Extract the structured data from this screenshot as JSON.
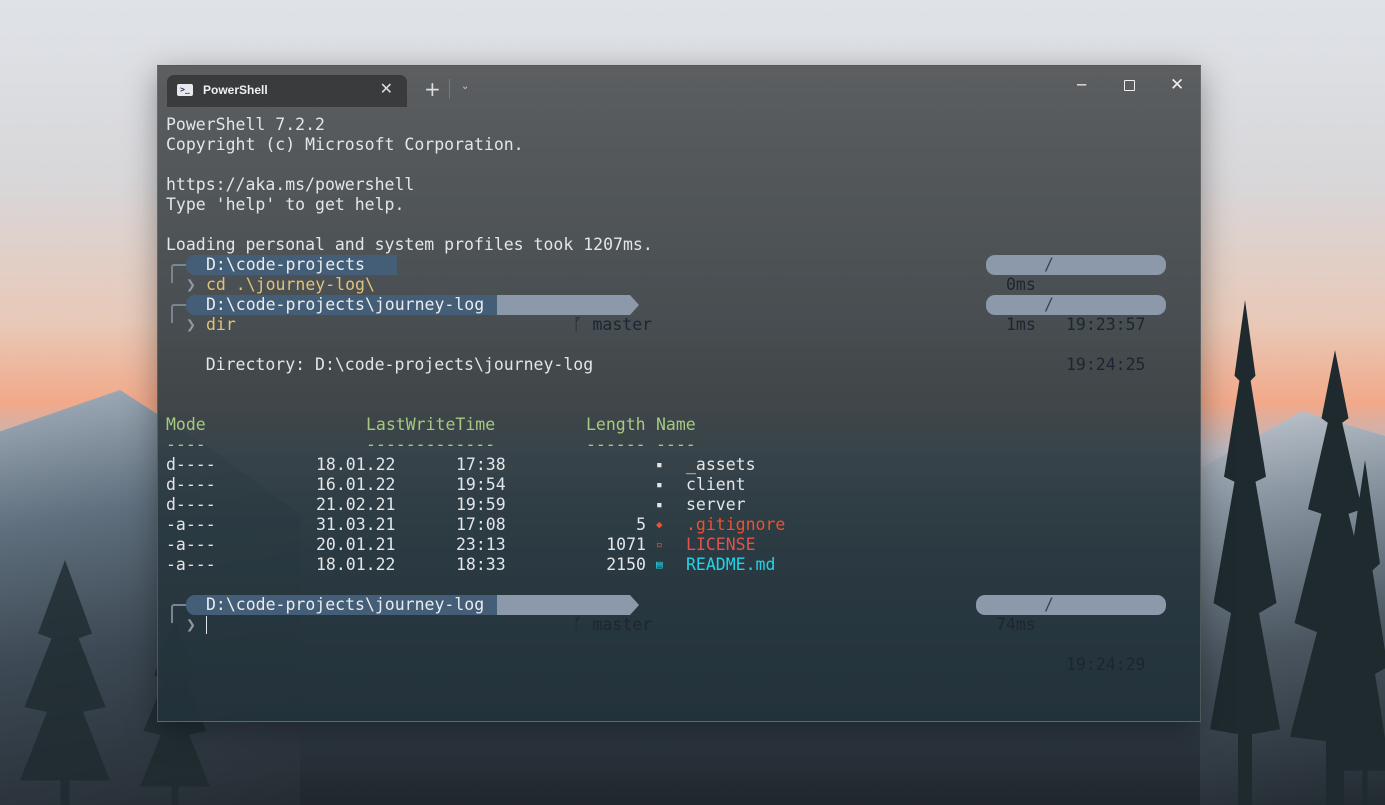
{
  "window": {
    "tab_title": "PowerShell",
    "tab_icon": "powershell-icon",
    "close_icon": "close-icon",
    "new_tab_icon": "plus-icon",
    "dropdown_icon": "chevron-down-icon",
    "controls": [
      "minimize-icon",
      "maximize-icon",
      "close-icon"
    ]
  },
  "banner": [
    "PowerShell 7.2.2",
    "Copyright (c) Microsoft Corporation.",
    "",
    "https://aka.ms/powershell",
    "Type 'help' to get help.",
    "",
    "Loading personal and system profiles took 1207ms."
  ],
  "prompts": [
    {
      "path": "D:\\code-projects",
      "branch": "",
      "duration": "0ms",
      "time": "19:23:57",
      "command": "cd .\\journey-log\\"
    },
    {
      "path": "D:\\code-projects\\journey-log",
      "branch": "master",
      "duration": "1ms",
      "time": "19:24:25",
      "command": "dir"
    },
    {
      "path": "D:\\code-projects\\journey-log",
      "branch": "master",
      "duration": "74ms",
      "time": "19:24:29",
      "command": ""
    }
  ],
  "git_icon": "git-branch-icon",
  "prompt_char": "❯",
  "directory_label": "    Directory: D:\\code-projects\\journey-log",
  "listing": {
    "headers": [
      "Mode",
      "LastWriteTime",
      "Length",
      "Name"
    ],
    "underlines": [
      "----",
      "-------------",
      "------",
      "----"
    ],
    "rows": [
      {
        "mode": "d----",
        "date": "18.01.22",
        "time": "17:38",
        "length": "",
        "icon": "folder-icon",
        "glyph": "▪",
        "name": "_assets"
      },
      {
        "mode": "d----",
        "date": "16.01.22",
        "time": "19:54",
        "length": "",
        "icon": "folder-icon",
        "glyph": "▪",
        "name": "client"
      },
      {
        "mode": "d----",
        "date": "21.02.21",
        "time": "19:59",
        "length": "",
        "icon": "folder-icon",
        "glyph": "▪",
        "name": "server"
      },
      {
        "mode": "-a---",
        "date": "31.03.21",
        "time": "17:08",
        "length": "5",
        "icon": "git-icon",
        "glyph": "◆",
        "name": ".gitignore"
      },
      {
        "mode": "-a---",
        "date": "20.01.21",
        "time": "23:13",
        "length": "1071",
        "icon": "license-icon",
        "glyph": "▫",
        "name": "LICENSE"
      },
      {
        "mode": "-a---",
        "date": "18.01.22",
        "time": "18:33",
        "length": "2150",
        "icon": "readme-icon",
        "glyph": "▤",
        "name": "README.md"
      }
    ]
  },
  "colors": {
    "header": "#a7c97f",
    "command": "#e0c27a",
    "gitignore": "#f1502f",
    "license": "#e2514f",
    "readme": "#22d4e8",
    "path_segment": "#455e78",
    "git_segment": "#8c99ab"
  }
}
